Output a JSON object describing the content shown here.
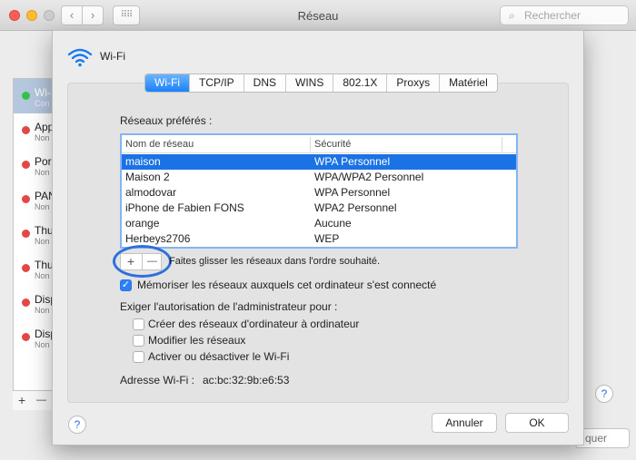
{
  "window": {
    "title": "Réseau",
    "search_placeholder": "Rechercher",
    "nav_back": "‹",
    "nav_forward": "›",
    "grid": "⠿⠿",
    "help": "?",
    "bg_button": "quer"
  },
  "sidebar": {
    "items": [
      {
        "name": "Wi-",
        "sub": "Con",
        "status": "green",
        "selected": true
      },
      {
        "name": "App",
        "sub": "Non",
        "status": "red"
      },
      {
        "name": "Por",
        "sub": "Non",
        "status": "red"
      },
      {
        "name": "PAN",
        "sub": "Non",
        "status": "red"
      },
      {
        "name": "Thu",
        "sub": "Non",
        "status": "red"
      },
      {
        "name": "Thu",
        "sub": "Non",
        "status": "red"
      },
      {
        "name": "Disp",
        "sub": "Non",
        "status": "red"
      },
      {
        "name": "Disp",
        "sub": "Non",
        "status": "red"
      }
    ],
    "add": "+",
    "remove": "—"
  },
  "sheet": {
    "header_label": "Wi-Fi",
    "tabs": [
      "Wi-Fi",
      "TCP/IP",
      "DNS",
      "WINS",
      "802.1X",
      "Proxys",
      "Matériel"
    ],
    "active_tab": "Wi-Fi",
    "preferred_label": "Réseaux préférés :",
    "table": {
      "col_name": "Nom de réseau",
      "col_security": "Sécurité",
      "rows": [
        {
          "name": "maison",
          "security": "WPA Personnel"
        },
        {
          "name": "Maison 2",
          "security": "WPA/WPA2 Personnel"
        },
        {
          "name": "almodovar",
          "security": "WPA Personnel"
        },
        {
          "name": "iPhone de Fabien FONS",
          "security": "WPA2 Personnel"
        },
        {
          "name": "orange",
          "security": "Aucune"
        },
        {
          "name": "Herbeys2706",
          "security": "WEP"
        }
      ]
    },
    "plus": "+",
    "minus": "—",
    "drag_hint": "Faites glisser les réseaux dans l'ordre souhaité.",
    "remember_label": "Mémoriser les réseaux auxquels cet ordinateur s'est connecté",
    "remember_checked": true,
    "admin_label": "Exiger l'autorisation de l'administrateur pour :",
    "admin_options": [
      {
        "label": "Créer des réseaux d'ordinateur à ordinateur",
        "checked": false
      },
      {
        "label": "Modifier les réseaux",
        "checked": false
      },
      {
        "label": "Activer ou désactiver le Wi-Fi",
        "checked": false
      }
    ],
    "address_label": "Adresse Wi-Fi :",
    "address_value": "ac:bc:32:9b:e6:53",
    "help": "?",
    "cancel": "Annuler",
    "ok": "OK"
  }
}
